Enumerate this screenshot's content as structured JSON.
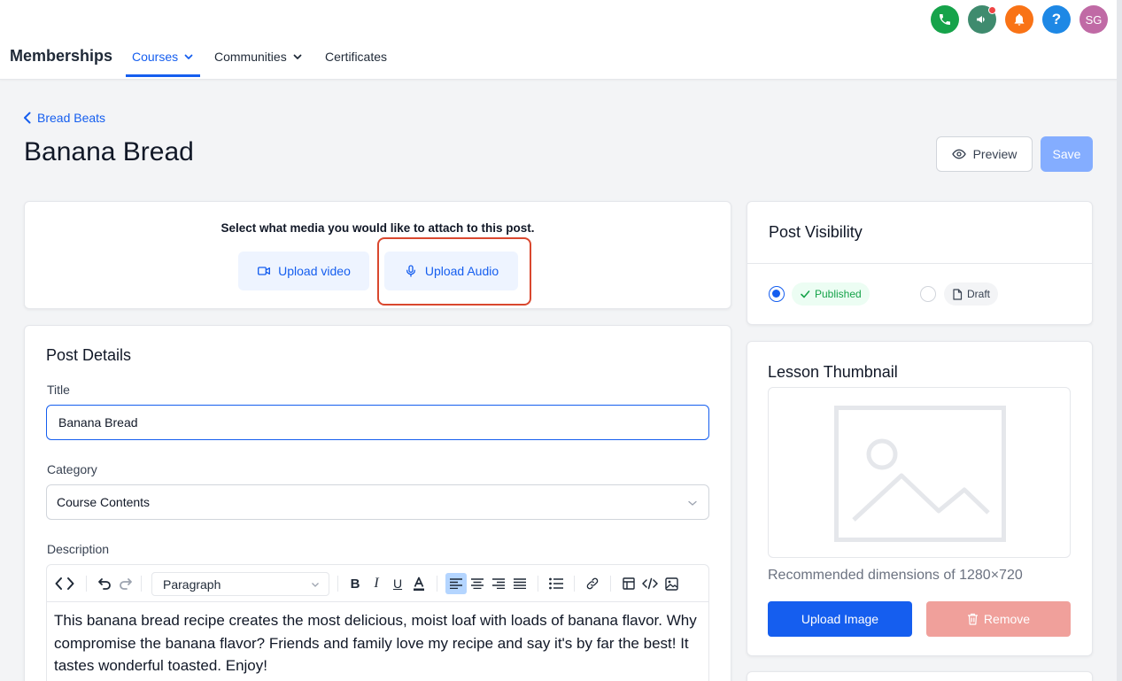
{
  "header": {
    "brand": "Memberships",
    "tabs": [
      {
        "label": "Courses"
      },
      {
        "label": "Communities"
      },
      {
        "label": "Certificates"
      }
    ],
    "avatar_initials": "SG",
    "help_glyph": "?",
    "icon_colors": {
      "phone": "#16a34a",
      "megaphone": "#3f8b6e",
      "bell": "#f97316",
      "help": "#1e88e5",
      "avatar": "#c06aa5"
    }
  },
  "breadcrumb": {
    "label": "Bread Beats"
  },
  "page": {
    "title": "Banana Bread"
  },
  "actions": {
    "preview_label": "Preview",
    "save_label": "Save"
  },
  "media": {
    "prompt": "Select what media you would like to attach to this post.",
    "video_label": "Upload video",
    "audio_label": "Upload Audio"
  },
  "post_details": {
    "heading": "Post Details",
    "title_label": "Title",
    "title_value": "Banana Bread",
    "category_label": "Category",
    "category_value": "Course Contents",
    "description_label": "Description",
    "block_format": "Paragraph",
    "description_text": "This banana bread recipe creates the most delicious, moist loaf with loads of banana flavor. Why compromise the banana flavor? Friends and family love my recipe and say it's by far the best! It tastes wonderful toasted. Enjoy!"
  },
  "visibility": {
    "heading": "Post Visibility",
    "published_label": "Published",
    "draft_label": "Draft",
    "selected": "Published"
  },
  "thumbnail": {
    "heading": "Lesson Thumbnail",
    "recommended_prefix": "Recommended dimensions of ",
    "recommended_value": "1280×720",
    "upload_label": "Upload Image",
    "remove_label": "Remove"
  },
  "colors": {
    "accent": "#155eef",
    "highlight": "#d9472e",
    "published_green": "#16a34a"
  }
}
